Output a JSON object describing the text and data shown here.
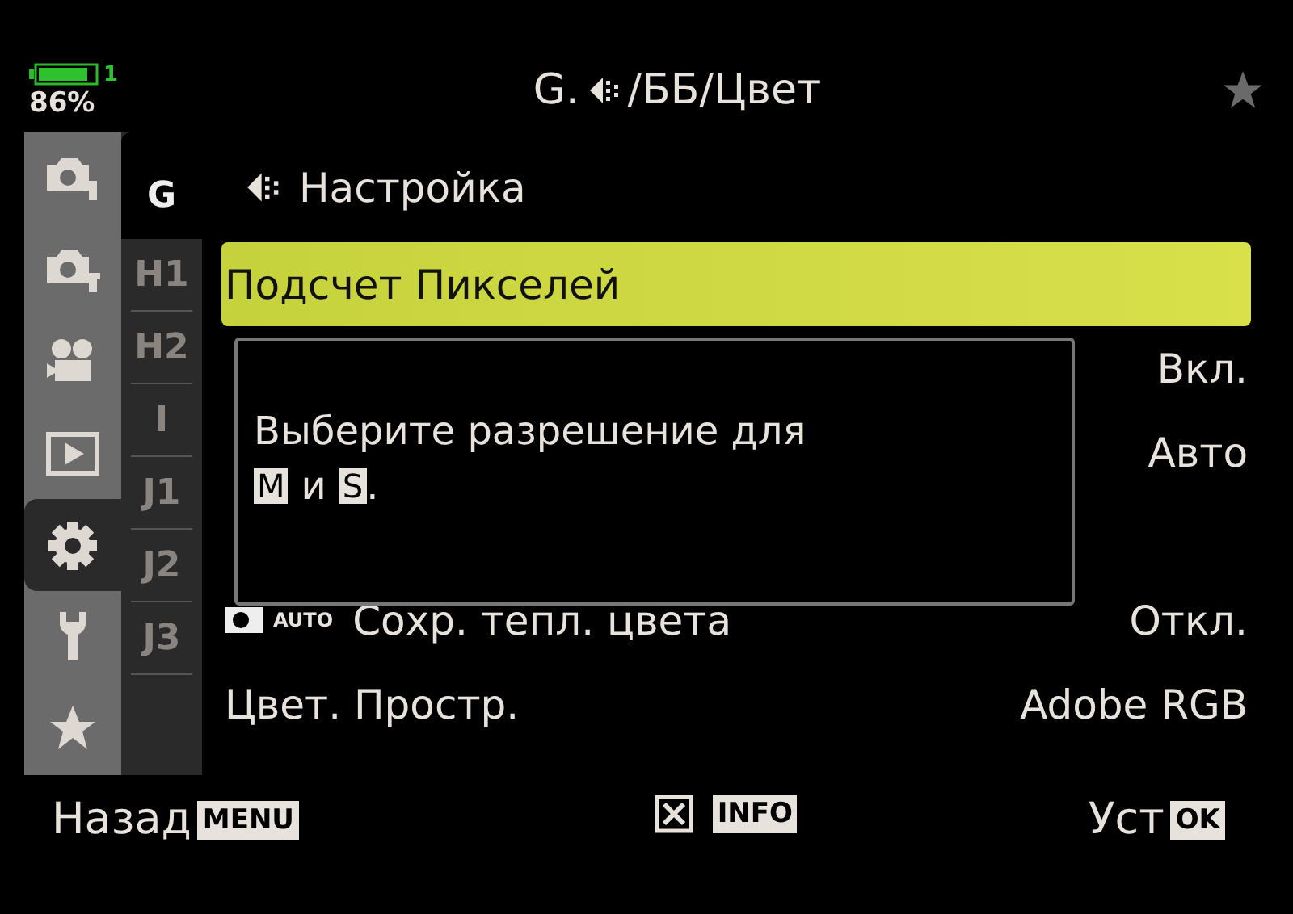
{
  "status": {
    "battery_index": "1",
    "battery_text": "86%"
  },
  "title": {
    "prefix": "G.",
    "suffix": "/ББ/Цвет"
  },
  "main_tabs": [
    {
      "kind": "camera1",
      "selected": false
    },
    {
      "kind": "camera2",
      "selected": false
    },
    {
      "kind": "video",
      "selected": false
    },
    {
      "kind": "playback",
      "selected": false
    },
    {
      "kind": "gear",
      "selected": true
    },
    {
      "kind": "wrench",
      "selected": false
    },
    {
      "kind": "star",
      "selected": false
    }
  ],
  "sub_tabs": [
    {
      "label": "G",
      "selected": true
    },
    {
      "label": "H1",
      "selected": false
    },
    {
      "label": "H2",
      "selected": false
    },
    {
      "label": "I",
      "selected": false
    },
    {
      "label": "J1",
      "selected": false
    },
    {
      "label": "J2",
      "selected": false
    },
    {
      "label": "J3",
      "selected": false
    }
  ],
  "section": {
    "title": "Настройка"
  },
  "items": [
    {
      "label": "Подсчет Пикселей",
      "selected": true
    },
    {
      "value": "Вкл.",
      "selected": false
    },
    {
      "value": "Авто",
      "selected": false
    },
    {
      "selected": false
    },
    {
      "icon_text": "AUTO",
      "label": "Сохр. тепл. цвета",
      "value": "Откл.",
      "selected": false
    },
    {
      "label": "Цвет. Простр.",
      "value": "Adobe RGB",
      "selected": false
    }
  ],
  "popup": {
    "line_1": "Выберите разрешение для",
    "line_2": [
      {
        "kind": "key",
        "text": "M"
      },
      {
        "kind": "text",
        "text": "и"
      },
      {
        "kind": "key",
        "text": "S"
      },
      {
        "kind": "text",
        "text": "."
      }
    ]
  },
  "footer": [
    {
      "label": "Назад",
      "key": "MENU"
    },
    {
      "kind": "icon",
      "key": "INFO"
    },
    {
      "label": "Уст",
      "key": "OK"
    }
  ]
}
